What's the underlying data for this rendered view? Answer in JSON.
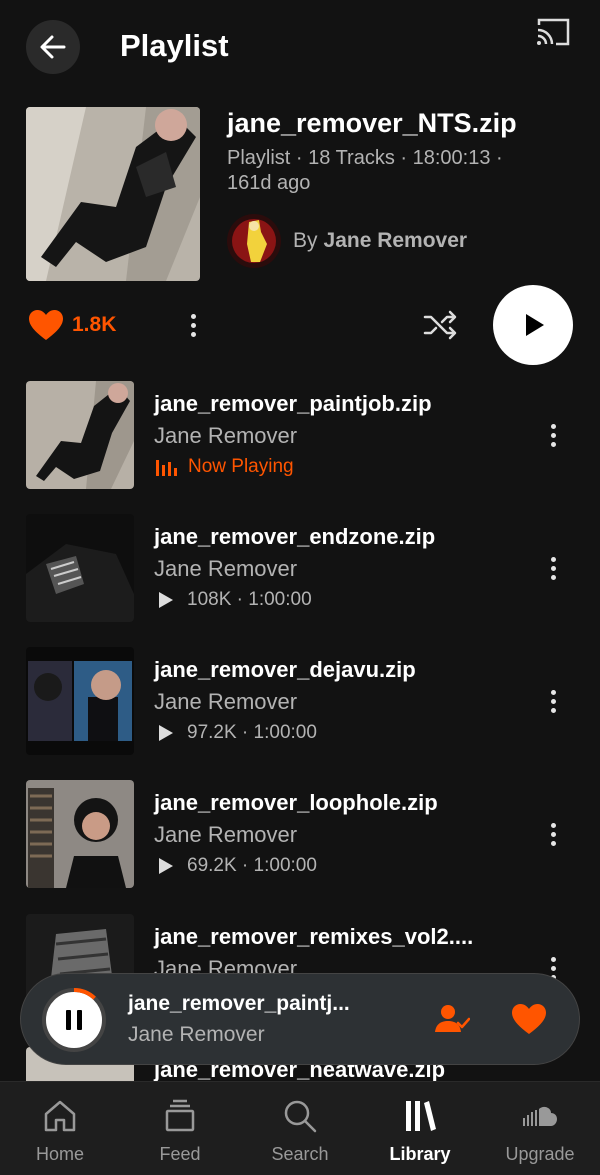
{
  "header": {
    "title": "Playlist"
  },
  "playlist": {
    "title": "jane_remover_NTS.zip",
    "meta": "Playlist · 18 Tracks · 18:00:13 · 161d ago",
    "by_label": "By",
    "author": "Jane Remover",
    "likes": "1.8K"
  },
  "tracks": [
    {
      "title": "jane_remover_paintjob.zip",
      "artist": "Jane Remover",
      "status": "Now Playing"
    },
    {
      "title": "jane_remover_endzone.zip",
      "artist": "Jane Remover",
      "stats": "108K · 1:00:00"
    },
    {
      "title": "jane_remover_dejavu.zip",
      "artist": "Jane Remover",
      "stats": "97.2K · 1:00:00"
    },
    {
      "title": "jane_remover_loophole.zip",
      "artist": "Jane Remover",
      "stats": "69.2K · 1:00:00"
    },
    {
      "title": "jane_remover_remixes_vol2....",
      "artist": "Jane Remover"
    },
    {
      "title": "jane_remover_heatwave.zip"
    }
  ],
  "mini_player": {
    "title": "jane_remover_paintj...",
    "artist": "Jane Remover",
    "progress": 0.12
  },
  "tabs": [
    {
      "label": "Home",
      "icon": "home-icon"
    },
    {
      "label": "Feed",
      "icon": "feed-icon"
    },
    {
      "label": "Search",
      "icon": "search-icon"
    },
    {
      "label": "Library",
      "icon": "library-icon",
      "active": true
    },
    {
      "label": "Upgrade",
      "icon": "soundcloud-icon"
    }
  ],
  "colors": {
    "accent": "#ff5500",
    "background": "#121212",
    "secondary_text": "#b3b3b3"
  }
}
